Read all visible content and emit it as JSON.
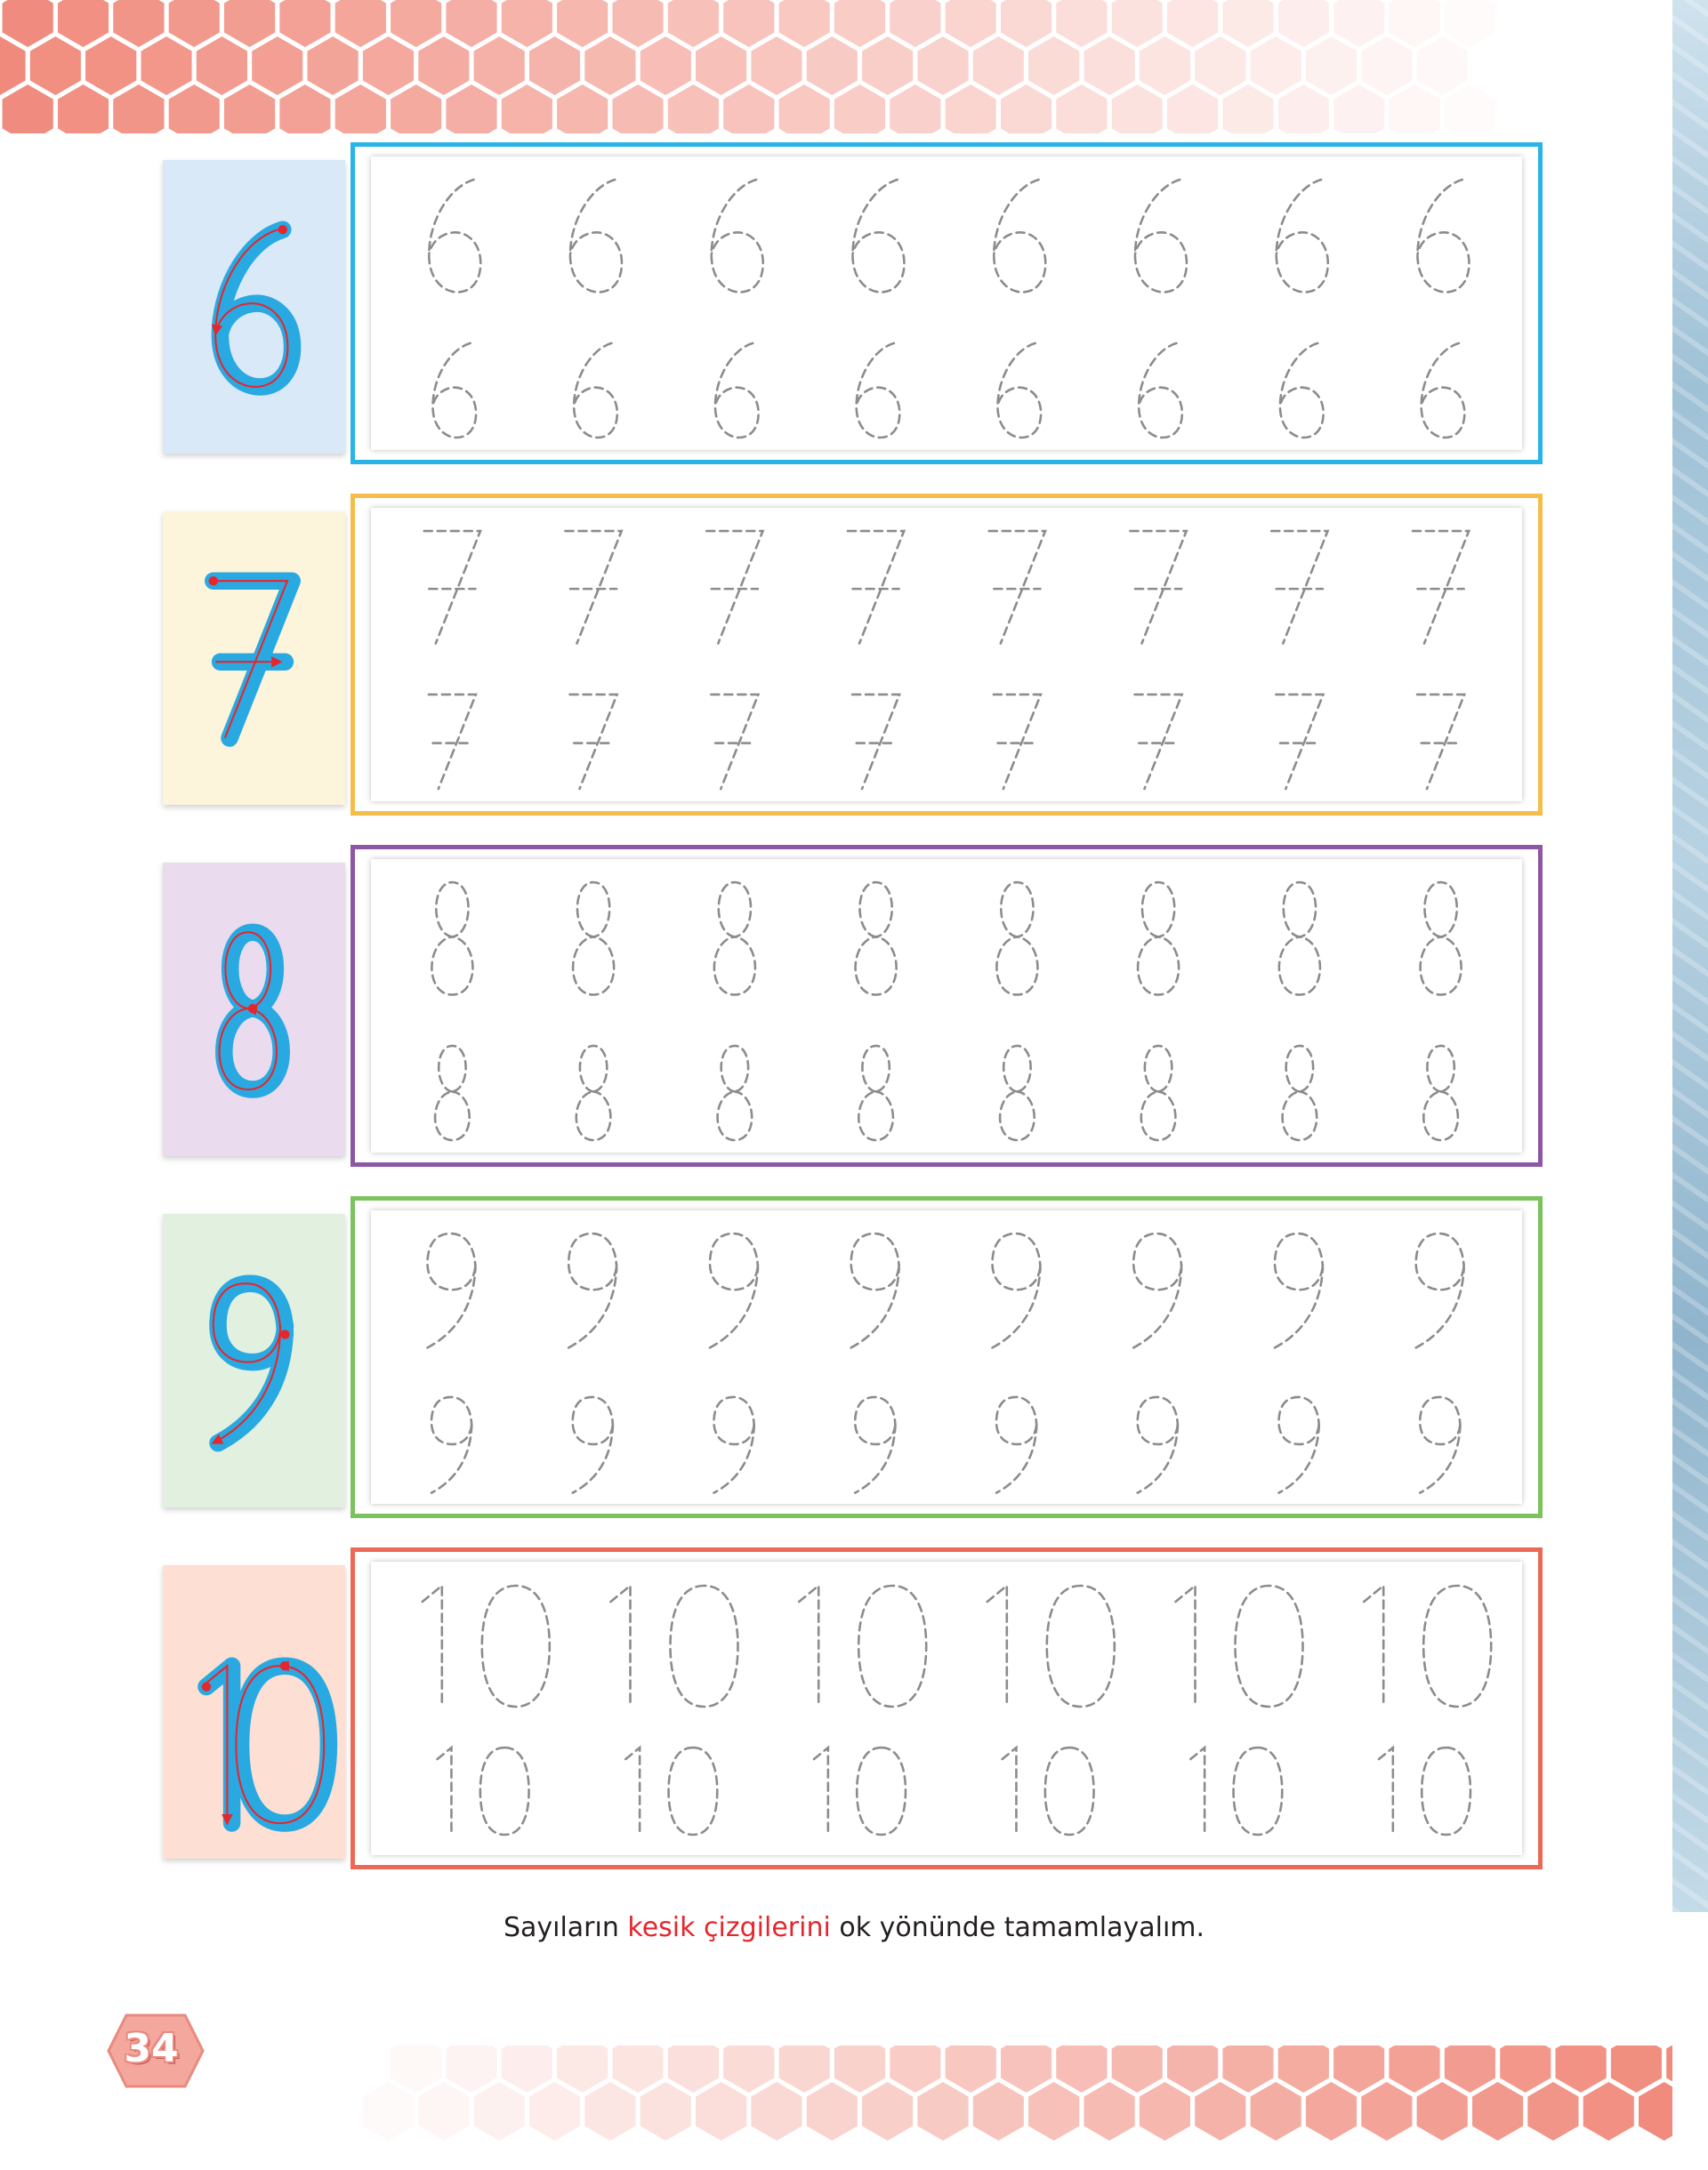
{
  "instruction": {
    "before": "Sayıların ",
    "highlight": "kesik çizgilerini",
    "after": " ok  yönünde tamamlayalım."
  },
  "page_number": "34",
  "colors": {
    "hex_accent": "#f08a7c",
    "model_digit": "#29a9e1",
    "guide_arrow": "#e5262d",
    "trace_dash": "#8c8c8c"
  },
  "rows": [
    {
      "digit": "6",
      "model_bg": "#d9e9f7",
      "border": "#29b4e8",
      "count_per_line": 8
    },
    {
      "digit": "7",
      "model_bg": "#fdf4dc",
      "border": "#f7bd4b",
      "count_per_line": 8
    },
    {
      "digit": "8",
      "model_bg": "#eadcee",
      "border": "#8e57a4",
      "count_per_line": 8
    },
    {
      "digit": "9",
      "model_bg": "#e1f0df",
      "border": "#7cc35e",
      "count_per_line": 8
    },
    {
      "digit": "10",
      "model_bg": "#fde0d3",
      "border": "#ec6a55",
      "count_per_line": 6
    }
  ]
}
